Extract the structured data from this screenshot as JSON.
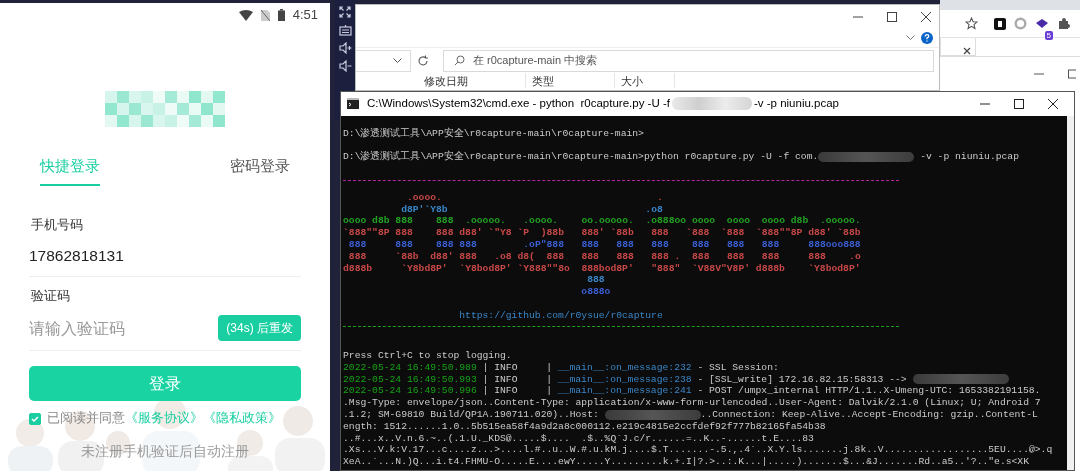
{
  "phone": {
    "status_bar": {
      "time": "4:51"
    },
    "tabs": [
      {
        "label": "快捷登录",
        "selected": true
      },
      {
        "label": "密码登录",
        "selected": false
      }
    ],
    "phone_field": {
      "label": "手机号码",
      "value": "17862818131"
    },
    "code_field": {
      "label": "验证码",
      "placeholder": "请输入验证码",
      "resend_button": "(34s) 后重发"
    },
    "login_button": "登录",
    "agreement": {
      "checked": true,
      "text": "已阅读并同意",
      "links": [
        "《服务协议》",
        "《隐私政策》"
      ]
    },
    "note": "未注册手机验证后自动注册"
  },
  "explorer": {
    "search": {
      "placeholder": "在 r0capture-main 中搜索"
    },
    "columns": [
      "修改日期",
      "类型",
      "大小"
    ]
  },
  "browser": {
    "extension_badge": "5"
  },
  "cmd": {
    "title": [
      {
        "kind": "text",
        "text": "C:\\Windows\\System32\\cmd.exe - python  r0capture.py -U -f"
      },
      {
        "kind": "redacted"
      },
      {
        "kind": "text",
        "text": "-v -p niuniu.pcap"
      }
    ],
    "lines": [
      {
        "kind": "blank"
      },
      {
        "kind": "text",
        "parts": [
          {
            "kind": "text",
            "text": "D:\\渗透测试工具\\APP安全\\r0capture-main\\r0capture-main>"
          }
        ]
      },
      {
        "kind": "blank"
      },
      {
        "kind": "text",
        "parts": [
          {
            "kind": "text",
            "text": "D:\\渗透测试工具\\APP安全\\r0capture-main\\r0capture-main>python r0capture.py -U -f com."
          },
          {
            "kind": "redacted"
          },
          {
            "kind": "text",
            "text": " -v -p niuniu.pcap"
          }
        ]
      },
      {
        "kind": "blank"
      },
      {
        "kind": "rule",
        "color": "#b4269a"
      },
      {
        "kind": "art",
        "color": "#c84848",
        "text": "           .oooo.                                     ."
      },
      {
        "kind": "art",
        "color": "#3a86c8",
        "text": "          d8P'`Y8b                                  .o8"
      },
      {
        "kind": "art",
        "color": "#22a422",
        "text": "oooo d8b 888    888  .ooooo.   .oooo.    oo.ooooo.  .o888oo oooo  oooo  oooo d8b  .ooooo."
      },
      {
        "kind": "art",
        "color": "#c84848",
        "text": "`888\"\"8P 888    888 d88' `\"Y8 `P  )88b   888' `88b   888   `888  `888  `888\"\"8P d88' `88b"
      },
      {
        "kind": "art",
        "color": "#3b5fd4",
        "text": " 888     888    888 888        .oP\"888   888   888   888    888   888   888     888ooo888"
      },
      {
        "kind": "art",
        "color": "#c84848",
        "text": " 888     `88b  d88' 888   .o8 d8(  888   888   888   888 .  888   888   888     888    .o"
      },
      {
        "kind": "art",
        "color": "#c84848",
        "text": "d888b     `Y8bd8P'  `Y8bod8P' `Y888\"\"8o  888bod8P'   \"888\"  `V88V\"V8P' d888b    `Y8bod8P'"
      },
      {
        "kind": "art",
        "color": "#3a86c8",
        "text": "                                          888"
      },
      {
        "kind": "art",
        "color": "#3b5fd4",
        "text": "                                         o888o"
      },
      {
        "kind": "blank"
      },
      {
        "kind": "url",
        "text": "                    https://github.com/r0ysue/r0capture"
      },
      {
        "kind": "rule",
        "color": "#1fa01f"
      },
      {
        "kind": "blank"
      },
      {
        "kind": "text",
        "parts": [
          {
            "kind": "text",
            "text": "Press Ctrl+C to stop logging."
          }
        ]
      },
      {
        "kind": "log",
        "time": "2022-05-24 16:49:50.989",
        "separator": "|",
        "level": "INFO",
        "source": "__main__:on_message:232",
        "parts": [
          {
            "kind": "text",
            "text": " - SSL Session:"
          }
        ]
      },
      {
        "kind": "log",
        "time": "2022-05-24 16:49:50.993",
        "separator": "|",
        "level": "INFO",
        "source": "__main__:on_message:238",
        "parts": [
          {
            "kind": "text",
            "text": " - [SSL_write] 172.16.82.15:58313 --> "
          },
          {
            "kind": "redacted"
          }
        ]
      },
      {
        "kind": "log",
        "time": "2022-05-24 16:49:50.996",
        "separator": "|",
        "level": "INFO",
        "source": "__main__:on_message:241",
        "parts": [
          {
            "kind": "text",
            "text": " - POST /umpx_internal HTTP/1.1..X-Umeng-UTC: 1653382191158."
          }
        ]
      },
      {
        "kind": "text",
        "parts": [
          {
            "kind": "text",
            "text": ".Msg-Type: envelope/json..Content-Type: application/x-www-form-urlencoded..User-Agent: Dalvik/2.1.0 (Linux; U; Android 7"
          }
        ]
      },
      {
        "kind": "text",
        "parts": [
          {
            "kind": "text",
            "text": ".1.2; SM-G9810 Build/QP1A.190711.020)..Host: "
          },
          {
            "kind": "redacted"
          },
          {
            "kind": "text",
            "text": "..Connection: Keep-Alive..Accept-Encoding: gzip..Content-L"
          }
        ]
      },
      {
        "kind": "text",
        "parts": [
          {
            "kind": "text",
            "text": "ength: 1512......1.0..5b515ea58f4a9d2a8c000112.e219c4815e2ccfdef92f777b82165fa54b38"
          }
        ]
      },
      {
        "kind": "text",
        "parts": [
          {
            "kind": "text",
            "text": "..#...x..V.n.6.~..(.1.U._KDS@.....$....  .$..%Q`J.c/r......=..K..-......t.E....83"
          }
        ]
      },
      {
        "kind": "text",
        "parts": [
          {
            "kind": "text",
            "text": ".Xs...V.k:V.17...c....z...>....l.#..u..W.#.u.kM.j....$.T.......-.5.,.4`..X.Y.ls.......j.8k..V..................5EU....@>.q"
          }
        ]
      },
      {
        "kind": "text",
        "parts": [
          {
            "kind": "text",
            "text": "XeA..`...N.)Q...i.t4.FHMU-O.....E....ewY.....Y.........k.+.I|?.>..:.K...|.....).......$...&J.......Rd..a5..'?..\"e.s<XK"
          }
        ]
      }
    ]
  }
}
